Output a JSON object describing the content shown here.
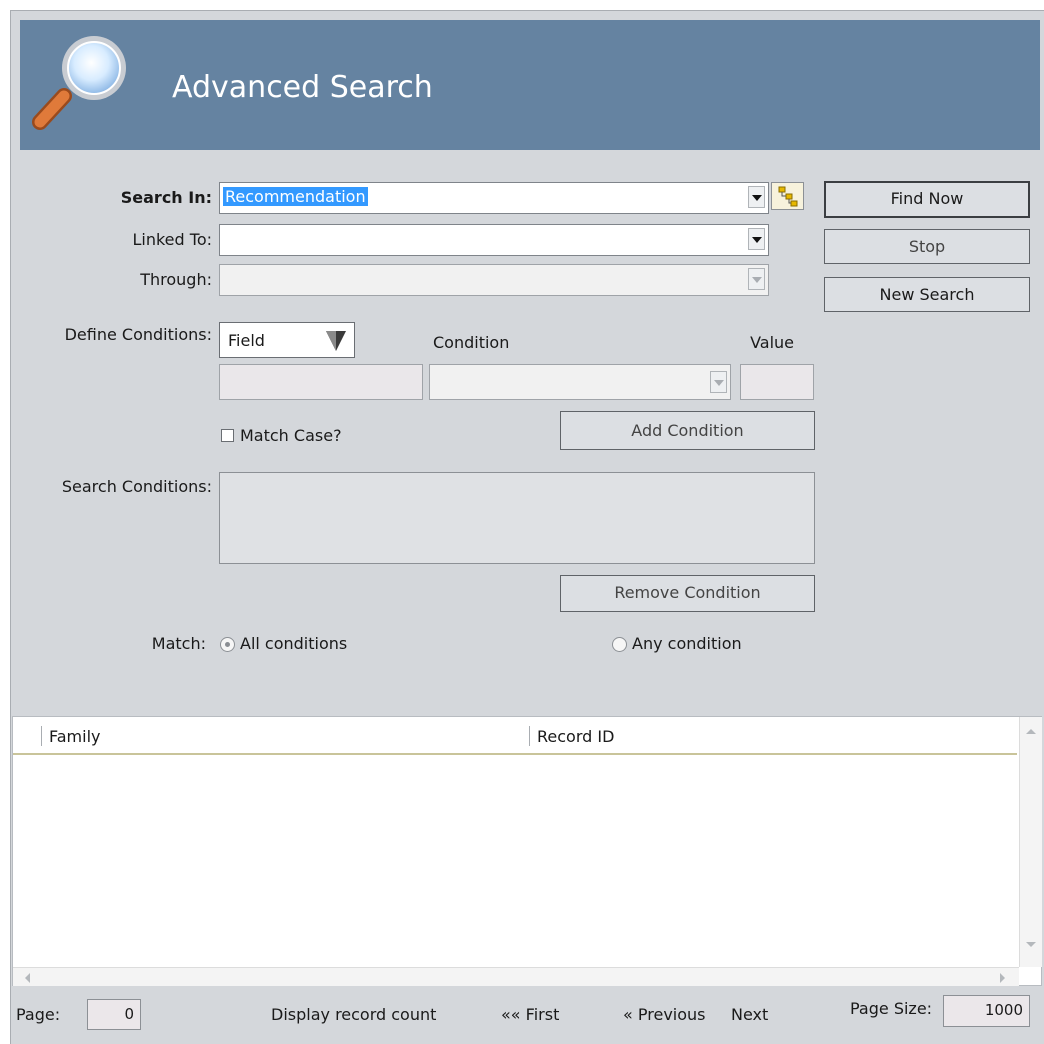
{
  "header": {
    "title": "Advanced Search"
  },
  "form": {
    "search_in_label": "Search In:",
    "search_in_value": "Recommendation",
    "linked_to_label": "Linked To:",
    "linked_to_value": "",
    "through_label": "Through:",
    "through_value": "",
    "define_conditions_label": "Define Conditions:",
    "field_button_label": "Field",
    "condition_header": "Condition",
    "value_header": "Value",
    "match_case_label": "Match Case?",
    "match_case_checked": false,
    "add_condition_label": "Add Condition",
    "search_conditions_label": "Search Conditions:",
    "remove_condition_label": "Remove Condition",
    "match_label": "Match:",
    "match_all_label": "All conditions",
    "match_any_label": "Any condition",
    "match_selected": "All conditions"
  },
  "actions": {
    "find_now": "Find Now",
    "stop": "Stop",
    "new_search": "New Search"
  },
  "results": {
    "columns": [
      "Family",
      "Record ID"
    ],
    "rows": []
  },
  "footer": {
    "page_label": "Page:",
    "page_value": "0",
    "display_count": "Display record count",
    "first": "«« First",
    "previous": "« Previous",
    "next": "Next",
    "page_size_label": "Page Size:",
    "page_size_value": "1000"
  },
  "colors": {
    "header_bg": "#6583a1",
    "panel_bg": "#d4d7db",
    "selection": "#3399ff"
  }
}
